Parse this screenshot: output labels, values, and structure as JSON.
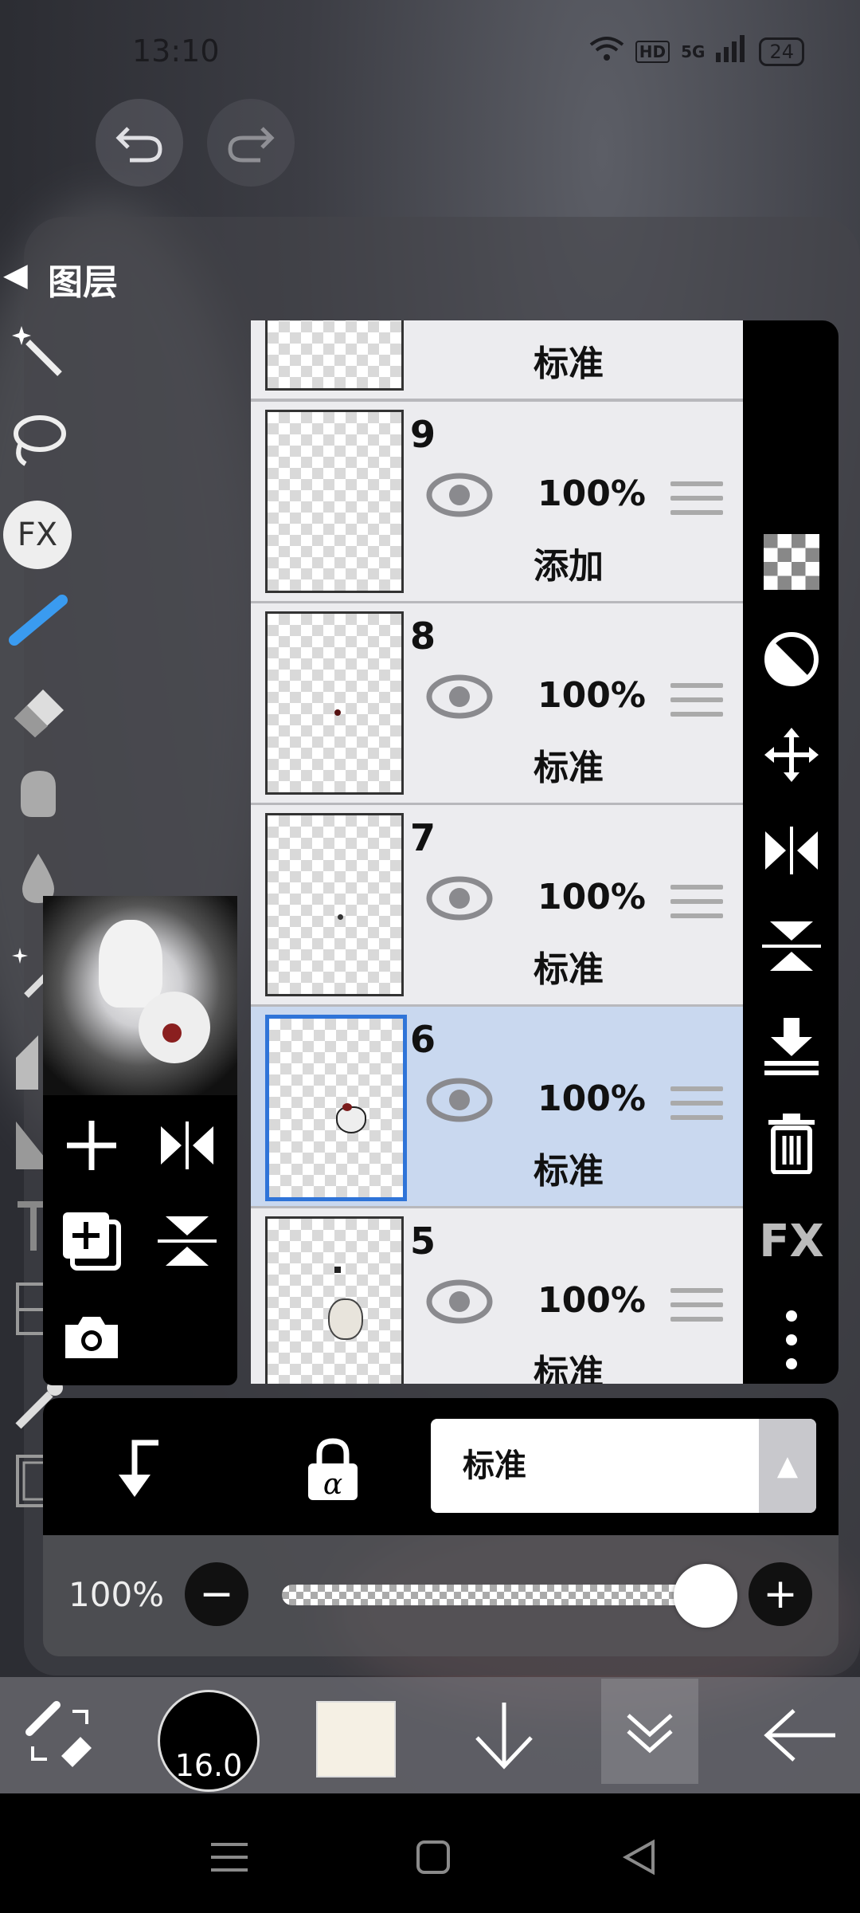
{
  "status_bar": {
    "time": "13:10",
    "signal": "5G",
    "hd": "HD",
    "battery": "24"
  },
  "history": {
    "undo_icon": "undo-icon",
    "redo_icon": "redo-icon"
  },
  "panel": {
    "title": "图层"
  },
  "layers": [
    {
      "number": "",
      "opacity": "",
      "blend": "标准",
      "selected": false,
      "partial": true
    },
    {
      "number": "9",
      "opacity": "100%",
      "blend": "添加",
      "selected": false
    },
    {
      "number": "8",
      "opacity": "100%",
      "blend": "标准",
      "selected": false
    },
    {
      "number": "7",
      "opacity": "100%",
      "blend": "标准",
      "selected": false
    },
    {
      "number": "6",
      "opacity": "100%",
      "blend": "标准",
      "selected": true
    },
    {
      "number": "5",
      "opacity": "100%",
      "blend": "标准",
      "selected": false
    }
  ],
  "right_tools": [
    "transparency-icon",
    "invert-icon",
    "move-icon",
    "flip-horizontal-icon",
    "flip-vertical-icon",
    "merge-down-icon",
    "trash-icon",
    "fx-icon",
    "more-icon"
  ],
  "right_fx_label": "FX",
  "left_tools_fx_label": "FX",
  "blend_mode": {
    "current": "标准"
  },
  "opacity": {
    "label": "100%",
    "value": 1.0
  },
  "bottom_bar": {
    "brush_size": "16.0",
    "color": "#f5f0e4"
  },
  "colors": {
    "selected_row": "#c9d8ef",
    "selected_border": "#2f74d8",
    "brush_accent": "#3a9bf0"
  }
}
